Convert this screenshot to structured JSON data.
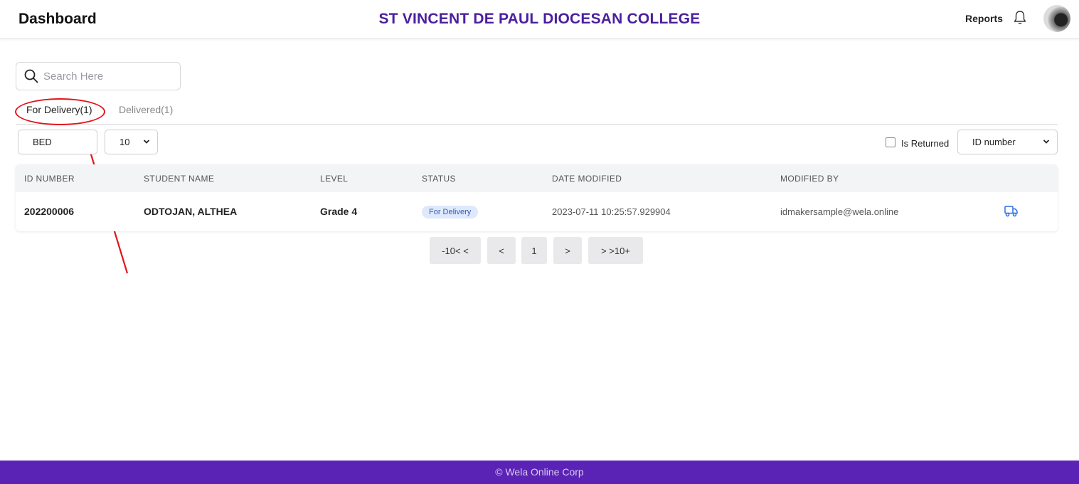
{
  "header": {
    "title": "Dashboard",
    "school_name": "ST VINCENT DE PAUL DIOCESAN COLLEGE",
    "reports_label": "Reports"
  },
  "search": {
    "placeholder": "Search Here",
    "value": ""
  },
  "tabs": [
    {
      "label": "For Delivery(1)",
      "active": true
    },
    {
      "label": "Delivered(1)",
      "active": false
    }
  ],
  "filters": {
    "department": "BED",
    "page_size": "10",
    "is_returned_label": "Is Returned",
    "is_returned_checked": false,
    "sort_by": "ID number"
  },
  "table": {
    "columns": [
      "ID NUMBER",
      "STUDENT NAME",
      "LEVEL",
      "STATUS",
      "DATE MODIFIED",
      "MODIFIED BY"
    ],
    "rows": [
      {
        "id_number": "202200006",
        "student_name": "ODTOJAN, ALTHEA",
        "level": "Grade 4",
        "status": "For Delivery",
        "date_modified": "2023-07-11 10:25:57.929904",
        "modified_by": "idmakersample@wela.online"
      }
    ]
  },
  "pagination": {
    "back10": "-10< <",
    "prev": "<",
    "current": "1",
    "next": ">",
    "fwd10": "> >10+"
  },
  "footer": {
    "text": "© Wela Online Corp"
  },
  "colors": {
    "brand_purple": "#4b1f9e",
    "footer_purple": "#5b23b5",
    "annotation_red": "#e3141b",
    "badge_blue": "#2c5cc5"
  },
  "icons": {
    "search": "search-icon",
    "bell": "bell-icon",
    "truck": "truck-icon",
    "chevron": "chevron-down-icon"
  }
}
